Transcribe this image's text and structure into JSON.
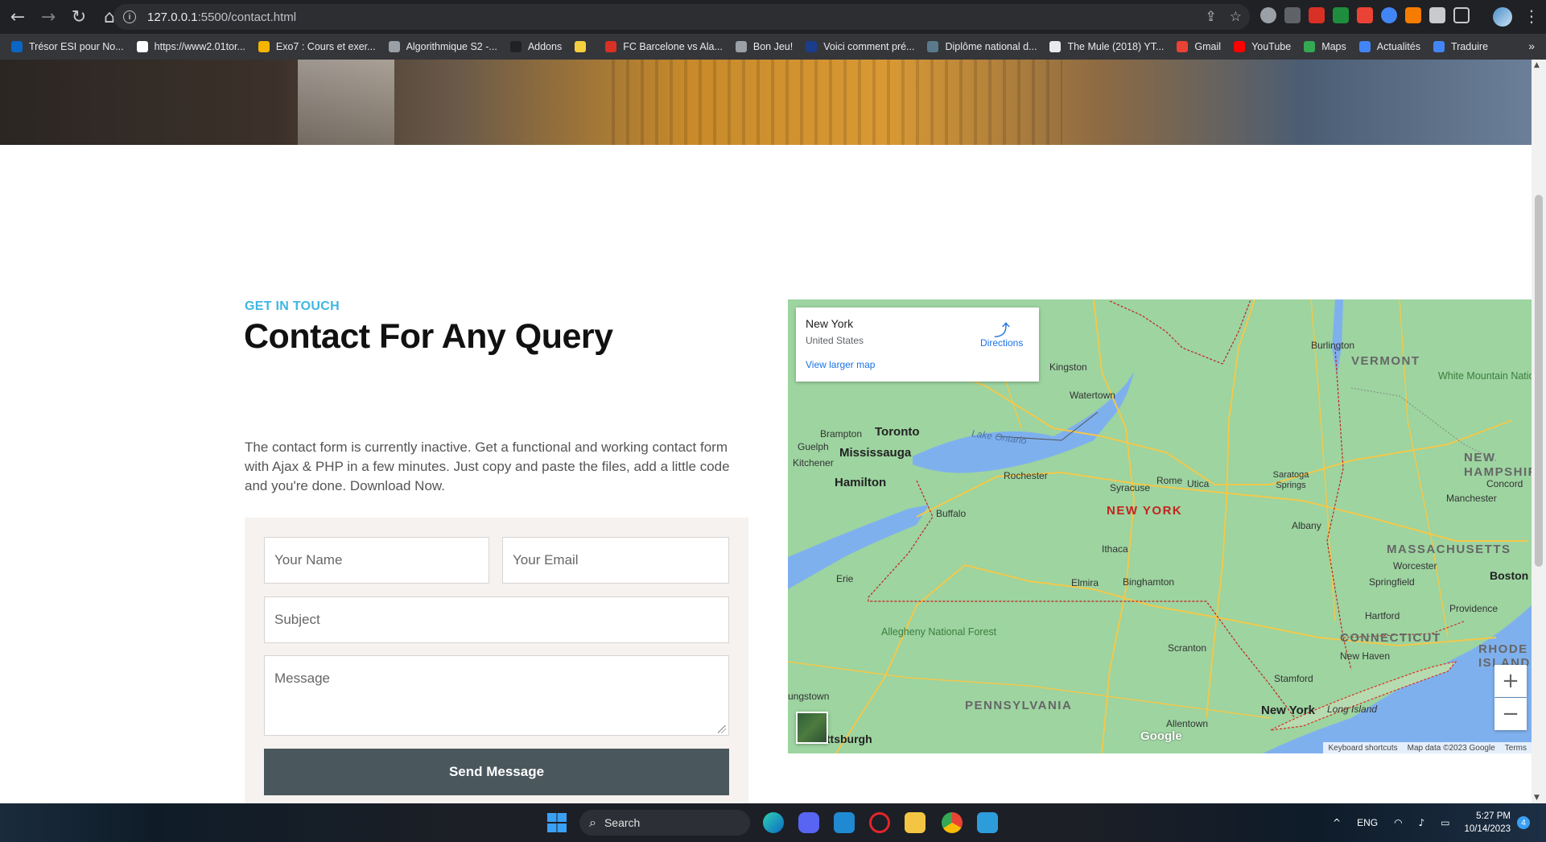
{
  "browser": {
    "url_host": "127.0.0.1",
    "url_path": ":5500/contact.html",
    "bookmarks": [
      {
        "label": "Trésor ESI pour No...",
        "color": "#0a66c2"
      },
      {
        "label": "https://www2.01tor...",
        "color": "#ffffff"
      },
      {
        "label": "Exo7 : Cours et exer...",
        "color": "#f4b400"
      },
      {
        "label": "Algorithmique S2 -...",
        "color": "#9aa0a6"
      },
      {
        "label": "Addons",
        "color": "#202124"
      },
      {
        "label": "",
        "color": "#f4d03f"
      },
      {
        "label": "FC Barcelone vs Ala...",
        "color": "#d93025"
      },
      {
        "label": "Bon Jeu!",
        "color": "#9aa0a6"
      },
      {
        "label": "Voici comment pré...",
        "color": "#1a3e8c"
      },
      {
        "label": "Diplôme national d...",
        "color": "#5a7a8c"
      },
      {
        "label": "The Mule (2018) YT...",
        "color": "#e8eaed"
      },
      {
        "label": "Gmail",
        "color": "#ea4335"
      },
      {
        "label": "YouTube",
        "color": "#ff0000"
      },
      {
        "label": "Maps",
        "color": "#34a853"
      },
      {
        "label": "Actualités",
        "color": "#4285f4"
      },
      {
        "label": "Traduire",
        "color": "#4285f4"
      }
    ],
    "bookmarks_overflow": "»"
  },
  "contact": {
    "eyebrow": "GET IN TOUCH",
    "title": "Contact For Any Query",
    "description": "The contact form is currently inactive. Get a functional and working contact form with Ajax & PHP in a few minutes. Just copy and paste the files, add a little code and you're done. Download Now.",
    "form": {
      "name_placeholder": "Your Name",
      "email_placeholder": "Your Email",
      "subject_placeholder": "Subject",
      "message_placeholder": "Message",
      "submit_label": "Send Message"
    }
  },
  "map": {
    "place_name": "New York",
    "place_sub": "United States",
    "directions_label": "Directions",
    "larger_map_label": "View larger map",
    "zoom_in": "+",
    "zoom_out": "−",
    "google_logo": "Google",
    "attribution": [
      "Keyboard shortcuts",
      "Map data ©2023 Google",
      "Terms"
    ],
    "labels": {
      "kingston": "Kingston",
      "watertown": "Watertown",
      "burlington": "Burlington",
      "vermont": "VERMONT",
      "white_mountain": "White Mountain National Forest",
      "new_hampshire": "NEW HAMPSHIRE",
      "concord": "Concord",
      "manchester": "Manchester",
      "brampton": "Brampton",
      "toronto": "Toronto",
      "mississauga": "Mississauga",
      "guelph": "Guelph",
      "kitchener": "Kitchener",
      "hamilton": "Hamilton",
      "lake_ontario": "Lake Ontario",
      "rochester": "Rochester",
      "syracuse": "Syracuse",
      "rome": "Rome",
      "utica": "Utica",
      "saratoga": "Saratoga Springs",
      "new_york_state": "NEW YORK",
      "buffalo": "Buffalo",
      "albany": "Albany",
      "ithaca": "Ithaca",
      "massachusetts": "MASSACHUSETTS",
      "worcester": "Worcester",
      "boston": "Boston",
      "erie": "Erie",
      "elmira": "Elmira",
      "binghamton": "Binghamton",
      "springfield": "Springfield",
      "hartford": "Hartford",
      "providence": "Providence",
      "allegheny": "Allegheny National Forest",
      "connecticut": "CONNECTICUT",
      "rhode_island": "RHODE ISLAND",
      "scranton": "Scranton",
      "new_haven": "New Haven",
      "stamford": "Stamford",
      "youngstown": "ungstown",
      "pennsylvania": "PENNSYLVANIA",
      "new_york_city": "New York",
      "long_island": "Long Island",
      "allentown": "Allentown",
      "pittsburgh": "ittsburgh"
    }
  },
  "taskbar": {
    "search_label": "Search",
    "language": "ENG",
    "time": "5:27 PM",
    "date": "10/14/2023",
    "notification_count": "4"
  }
}
